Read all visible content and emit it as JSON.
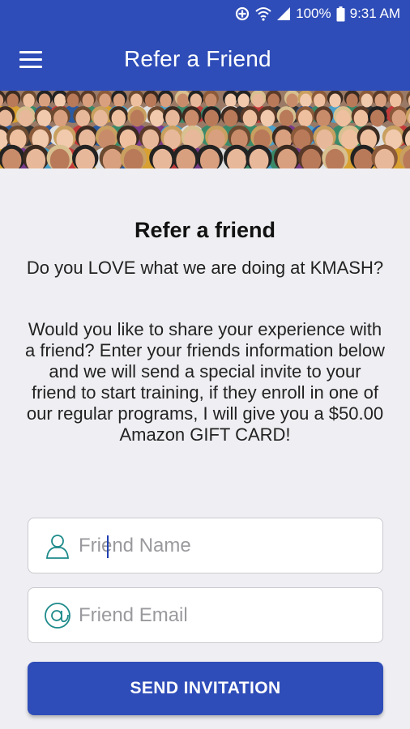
{
  "status_bar": {
    "battery": "100%",
    "time": "9:31 AM",
    "icons": [
      "data-saver-icon",
      "wifi-icon",
      "signal-icon",
      "battery-icon"
    ]
  },
  "app_bar": {
    "title": "Refer a Friend",
    "menu_icon": "hamburger-menu-icon"
  },
  "hero": {
    "image": "crowd-of-people-photo"
  },
  "content": {
    "heading": "Refer a friend",
    "question": "Do you LOVE what we are doing at KMASH?",
    "body": "Would you like to share your experience with a friend? Enter your friends information below and we will send a special invite to your friend to start training, if they enroll in one of our regular programs, I will give you a $50.00 Amazon GIFT CARD!"
  },
  "form": {
    "name_placeholder": "Friend Name",
    "name_value": "",
    "name_icon": "person-icon",
    "email_placeholder": "Friend Email",
    "email_value": "",
    "email_icon": "at-sign-icon",
    "submit_label": "SEND INVITATION"
  },
  "colors": {
    "primary": "#2f4db8",
    "background": "#efeff3",
    "icon_teal": "#1e8a8a"
  }
}
